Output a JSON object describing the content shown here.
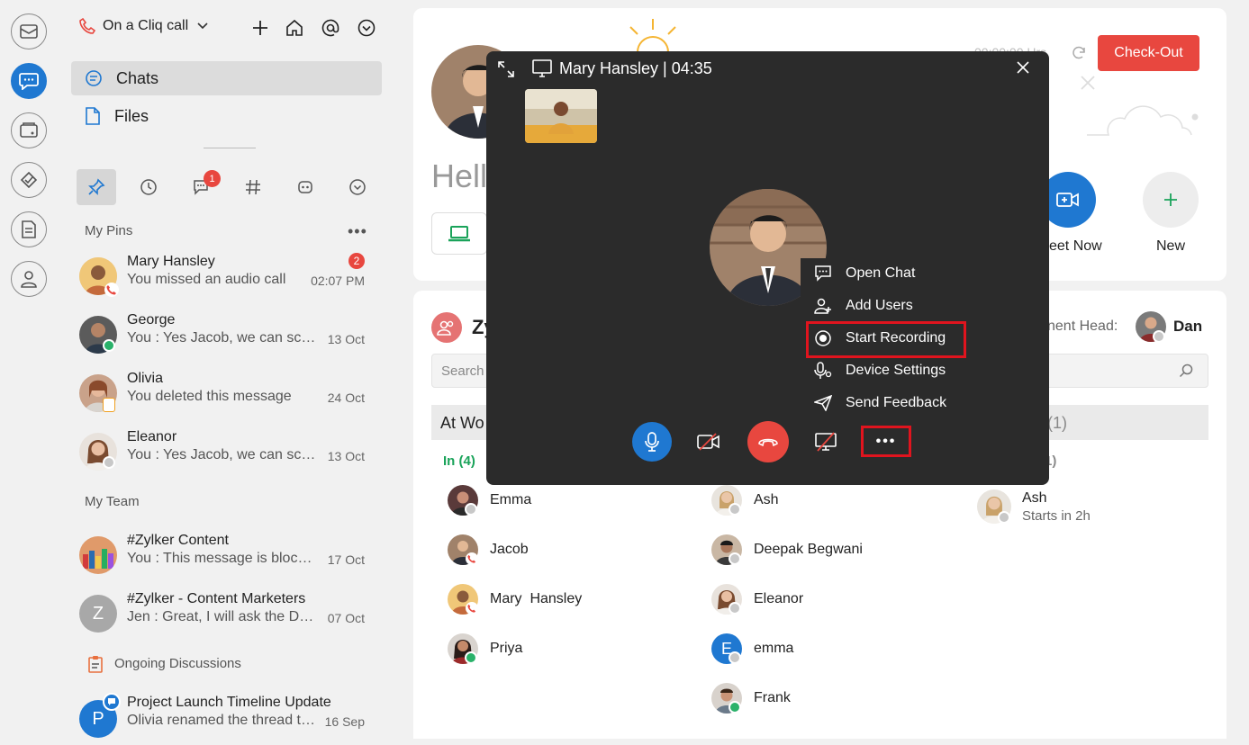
{
  "status": {
    "label": "On a Cliq call"
  },
  "nav": {
    "chats": "Chats",
    "files": "Files"
  },
  "tabs": {
    "unread_badge": "1"
  },
  "pins": {
    "title": "My Pins",
    "items": [
      {
        "name": "Mary Hansley",
        "msg": "You missed an audio call",
        "time": "02:07 PM",
        "badge": "2"
      },
      {
        "name": "George",
        "msg": "You : Yes Jacob, we can schedule",
        "time": "13 Oct"
      },
      {
        "name": "Olivia",
        "msg": "You deleted this message",
        "time": "24 Oct"
      },
      {
        "name": "Eleanor",
        "msg": "You : Yes Jacob, we can schedule",
        "time": "13 Oct"
      }
    ]
  },
  "team": {
    "title": "My Team",
    "items": [
      {
        "name": "#Zylker Content",
        "msg": "You : This message is blocked",
        "time": "17 Oct"
      },
      {
        "name": "#Zylker - Content Marketers",
        "msg": "Jen : Great, I will ask the Design team",
        "time": "07 Oct",
        "initial": "Z"
      }
    ]
  },
  "discussions": {
    "title": "Ongoing Discussions",
    "items": [
      {
        "name": "Project Launch Timeline Update",
        "msg": "Olivia renamed the thread title",
        "time": "16 Sep",
        "initial": "P"
      }
    ]
  },
  "home": {
    "greeting": "Hell",
    "timer": "00:00:00 Hrs",
    "checkout": "Check-Out",
    "meet_now": "eet Now",
    "new": "New"
  },
  "team_card": {
    "title": "Zy",
    "head_label": "nent Head:",
    "head_name": "Dan",
    "search_placeholder": "Search",
    "at_work": "At Wo",
    "count_right": "(1)",
    "in_label": "In (4)",
    "col3_label": "1)",
    "col1": [
      "Emma",
      "Jacob",
      "Mary  Hansley",
      "Priya"
    ],
    "col2": [
      "Ash",
      "Deepak Begwani",
      "Eleanor",
      "emma",
      "Frank"
    ],
    "col2_e_initial": "E",
    "col3": {
      "name": "Ash",
      "sub": "Starts in 2h"
    }
  },
  "call": {
    "title": "Mary Hansley | 04:35",
    "menu": [
      "Open Chat",
      "Add Users",
      "Start Recording",
      "Device Settings",
      "Send Feedback"
    ],
    "more": "•••"
  },
  "colors": {
    "accent": "#1f78d1",
    "danger": "#e8473f",
    "highlight": "#e0141e",
    "online": "#2ab26a"
  }
}
